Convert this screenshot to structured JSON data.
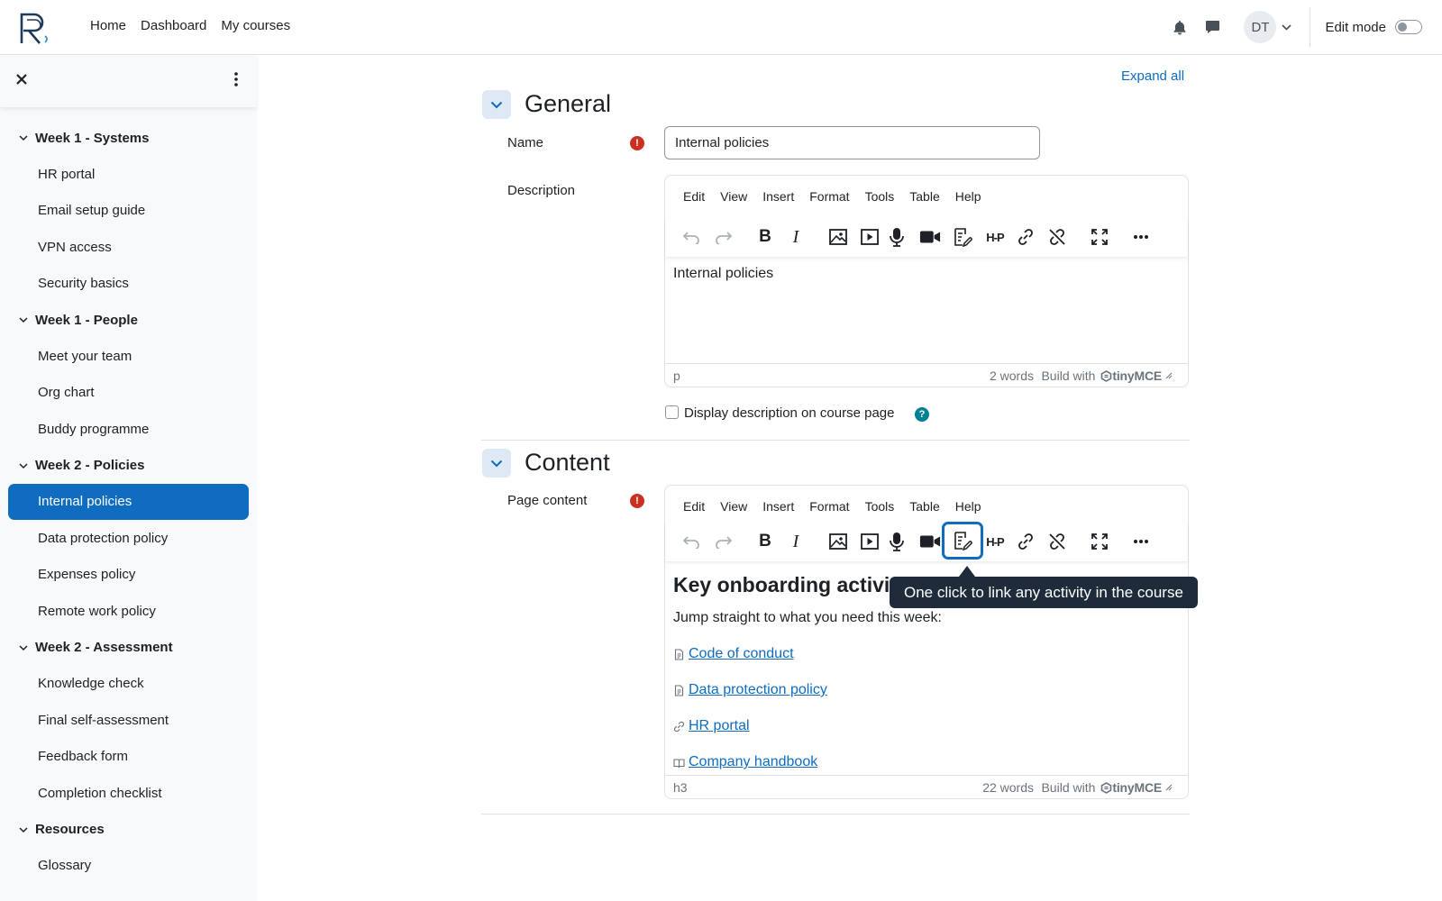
{
  "nav": {
    "links": [
      "Home",
      "Dashboard",
      "My courses"
    ],
    "avatar_initials": "DT",
    "edit_mode_label": "Edit mode"
  },
  "sidebar": {
    "sections": [
      {
        "title": "Week 1 - Systems",
        "items": [
          "HR portal",
          "Email setup guide",
          "VPN access",
          "Security basics"
        ]
      },
      {
        "title": "Week 1 - People",
        "items": [
          "Meet your team",
          "Org chart",
          "Buddy programme"
        ]
      },
      {
        "title": "Week 2 - Policies",
        "items": [
          "Internal policies",
          "Data protection policy",
          "Expenses policy",
          "Remote work policy"
        ]
      },
      {
        "title": "Week 2 - Assessment",
        "items": [
          "Knowledge check",
          "Final self-assessment",
          "Feedback form",
          "Completion checklist"
        ]
      },
      {
        "title": "Resources",
        "items": [
          "Glossary"
        ]
      }
    ],
    "active_item": "Internal policies"
  },
  "form": {
    "expand_all": "Expand all",
    "general_title": "General",
    "name_label": "Name",
    "name_value": "Internal policies",
    "description_label": "Description",
    "description_text": "Internal policies",
    "description_status_tag": "p",
    "description_words": "2 words",
    "display_description_label": "Display description on course page",
    "content_title": "Content",
    "page_content_label": "Page content",
    "content_heading": "Key onboarding activiti",
    "content_intro": "Jump straight to what you need this week:",
    "content_links": [
      {
        "text": "Code of conduct",
        "icon": "page-icon"
      },
      {
        "text": "Data protection policy",
        "icon": "page-icon"
      },
      {
        "text": "HR portal",
        "icon": "link-icon"
      },
      {
        "text": "Company handbook",
        "icon": "book-icon"
      }
    ],
    "content_status_tag": "h3",
    "content_words": "22 words"
  },
  "editor": {
    "menu": [
      "Edit",
      "View",
      "Insert",
      "Format",
      "Tools",
      "Table",
      "Help"
    ],
    "build_with": "Build with",
    "brand": "tinyMCE"
  },
  "tooltip": "One click to link any activity in the course",
  "colors": {
    "accent": "#0f6cbf",
    "required": "#ca3120",
    "tooltip_bg": "#1d2b3a",
    "help": "#008196"
  }
}
